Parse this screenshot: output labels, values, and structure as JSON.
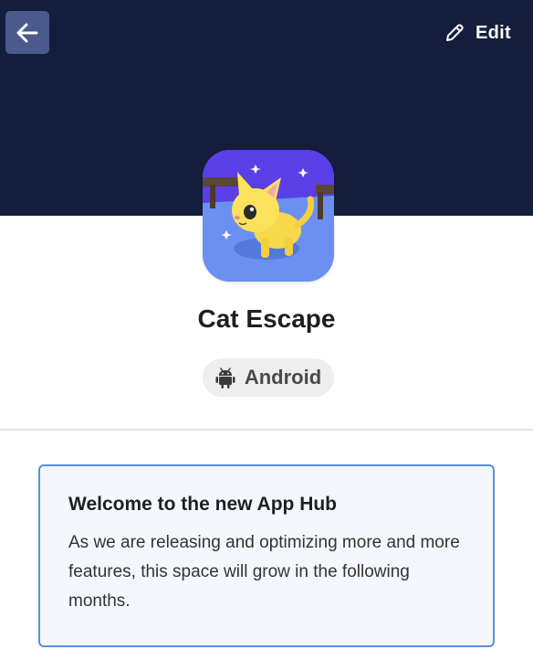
{
  "header": {
    "back_icon": "arrow-left-icon",
    "edit_icon": "pencil-icon",
    "edit_label": "Edit",
    "background_color": "#141d3b",
    "back_button_color": "#4b5a8c"
  },
  "app": {
    "name": "Cat Escape",
    "icon": "cat-escape-app-icon",
    "platform": {
      "icon": "android-icon",
      "label": "Android"
    }
  },
  "welcome_card": {
    "title": "Welcome to the new App Hub",
    "body": "As we are releasing and optimizing more and more features, this space will grow in the following months.",
    "border_color": "#5a8fd6",
    "background_color": "#f4f8fe"
  }
}
